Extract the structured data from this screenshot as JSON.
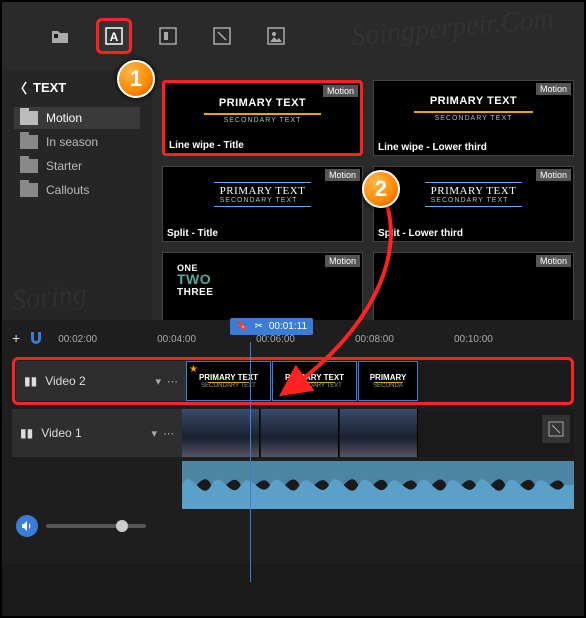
{
  "toolbar": {
    "buttons": [
      "media-tab",
      "text-tab",
      "transitions-tab",
      "effects-tab",
      "overlays-tab"
    ]
  },
  "sidebar": {
    "back_label": "TEXT",
    "folders": [
      {
        "label": "Motion",
        "active": true
      },
      {
        "label": "In season",
        "active": false
      },
      {
        "label": "Starter",
        "active": false
      },
      {
        "label": "Callouts",
        "active": false
      }
    ]
  },
  "presets": [
    {
      "badge": "Motion",
      "title": "PRIMARY TEXT",
      "subtitle": "SECONDARY TEXT",
      "caption": "Line wipe - Title",
      "highlight": true,
      "style": "underline"
    },
    {
      "badge": "Motion",
      "title": "PRIMARY TEXT",
      "subtitle": "SECONDARY TEXT",
      "caption": "Line wipe - Lower third",
      "style": "underline"
    },
    {
      "badge": "Motion",
      "title": "PRIMARY TEXT",
      "subtitle": "SECONDARY TEXT",
      "caption": "Split - Title",
      "style": "split"
    },
    {
      "badge": "Motion",
      "title": "PRIMARY TEXT",
      "subtitle": "SECONDARY TEXT",
      "caption": "Split - Lower third",
      "style": "split"
    },
    {
      "badge": "Motion",
      "title": "",
      "subtitle": "",
      "caption": "",
      "style": "stack",
      "stack": [
        "ONE",
        "TWO",
        "THREE"
      ]
    },
    {
      "badge": "Motion",
      "title": "",
      "subtitle": "",
      "caption": "",
      "style": "blank"
    }
  ],
  "timeline": {
    "controls_add": "+",
    "playhead_time": "00:01:11",
    "ticks": [
      "00:02:00",
      "00:04:00",
      "00:06:00",
      "00:08:00",
      "00:10:00"
    ],
    "tracks": [
      {
        "name": "Video 2",
        "type": "video",
        "highlight": true,
        "clips": [
          {
            "title": "PRIMARY TEXT",
            "subtitle": "SECONDARY TEXT",
            "star": true
          },
          {
            "title": "PRIMARY TEXT",
            "subtitle": "SECONDARY TEXT"
          },
          {
            "title": "PRIMARY",
            "subtitle": "SECONDA"
          }
        ]
      },
      {
        "name": "Video 1",
        "type": "video",
        "thumbs": 3
      },
      {
        "name": "",
        "type": "audio"
      }
    ]
  },
  "callouts": {
    "one": "1",
    "two": "2"
  }
}
